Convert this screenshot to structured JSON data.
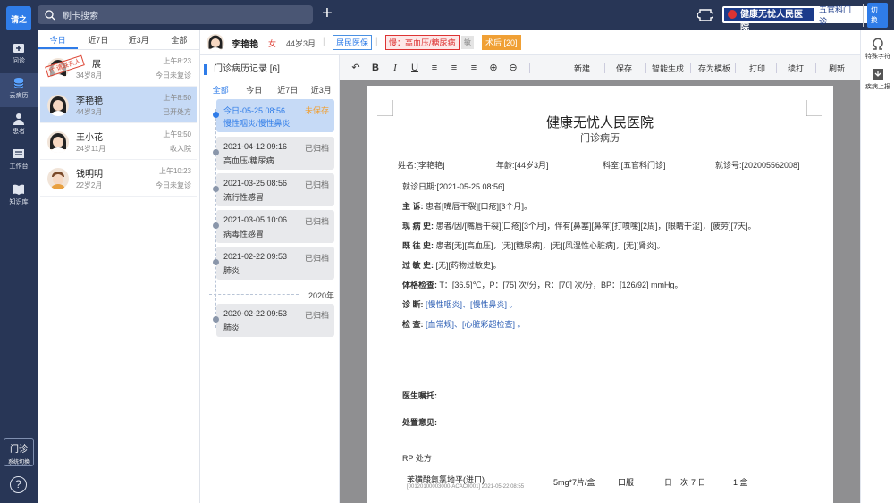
{
  "app": {
    "logo_label": "请之",
    "search_placeholder": "刷卡搜索",
    "plus": "+",
    "hospital_name": "健康无忧人民医院",
    "department": "五官科门诊",
    "switch_label": "切换"
  },
  "leftnav": [
    {
      "label": "问诊",
      "icon": "consult-icon"
    },
    {
      "label": "云病历",
      "icon": "cloud-record-icon"
    },
    {
      "label": "患者",
      "icon": "patient-icon"
    },
    {
      "label": "工作台",
      "icon": "workbench-icon"
    },
    {
      "label": "知识库",
      "icon": "knowledge-icon"
    }
  ],
  "clinic_switch": {
    "label": "门诊",
    "sub": "系统切换"
  },
  "help": "?",
  "patient_tabs": [
    "今日",
    "近7日",
    "近3月",
    "全部"
  ],
  "patients": [
    {
      "name": "展",
      "info": "34岁8月",
      "time": "上午8:23",
      "status": "今日未复诊",
      "stamp": "代 请联系人"
    },
    {
      "name": "李艳艳",
      "info": "44岁3月",
      "time": "上午8:50",
      "status": "已开处方"
    },
    {
      "name": "王小花",
      "info": "24岁11月",
      "time": "上午9:50",
      "status": "收入院"
    },
    {
      "name": "钱明明",
      "info": "22岁2月",
      "time": "上午10:23",
      "status": "今日未复诊"
    }
  ],
  "current_patient": {
    "name": "李艳艳",
    "sex": "女",
    "age": "44岁3月",
    "sep": "|",
    "insurance": "居民医保",
    "chronic": "慢：高血压/糖尿病",
    "shield": "敏",
    "post_op": "术后 [20]"
  },
  "right_tools": [
    {
      "label": "特殊字符",
      "icon": "omega-icon"
    },
    {
      "label": "疾病上报",
      "icon": "report-icon"
    }
  ],
  "history": {
    "title": "门诊病历记录 [6]",
    "tabs": [
      "全部",
      "今日",
      "近7日",
      "近3月"
    ],
    "records": [
      {
        "date": "今日-05-25  08:56",
        "status": "未保存",
        "diag": "慢性咽炎/慢性鼻炎"
      },
      {
        "date": "2021-04-12  09:16",
        "status": "已归档",
        "diag": "高血压/糖尿病"
      },
      {
        "date": "2021-03-25  08:56",
        "status": "已归档",
        "diag": "流行性感冒"
      },
      {
        "date": "2021-03-05  10:06",
        "status": "已归档",
        "diag": "病毒性感冒"
      },
      {
        "date": "2021-02-22  09:53",
        "status": "已归档",
        "diag": "肺炎"
      },
      {
        "date": "2020-02-22  09:53",
        "status": "已归档",
        "diag": "肺炎"
      }
    ],
    "year_label": "2020年"
  },
  "toolbar": {
    "actions": [
      "新建",
      "保存",
      "智能生成",
      "存为模板",
      "打印",
      "续打",
      "刷新"
    ]
  },
  "document": {
    "title": "健康无忧人民医院",
    "subtitle": "门诊病历",
    "name": "姓名:[李艳艳]",
    "age": "年龄:[44岁3月]",
    "dept": "科室:[五官科门诊]",
    "visit_no": "就诊号:[202005562008]",
    "visit_date": "就诊日期:[2021-05-25   08:56]",
    "complaint_label": "主      诉:",
    "complaint": "患者[嘴唇干裂][口疮][3个月]。",
    "present_label": "现 病 史:",
    "present": "患者/因/[嘴唇干裂][口疮][3个月]，伴有[鼻塞][鼻痒][打喷嚏][2周]，[眼睛干涩]，[疲劳][7天]。",
    "past_label": "既 往 史:",
    "past": "患者[无][高血压]，[无][糖尿病]，[无][风湿性心脏病]，[无][肾炎]。",
    "allergy_label": "过 敏 史:",
    "allergy": "[无][药物过敏史]。",
    "exam_label": "体格检查:",
    "exam": "T：[36.5]℃，P：[75] 次/分，R：[70] 次/分，BP：[126/92] mmHg。",
    "diag_label": "诊      断:",
    "diag": "[慢性咽炎]、[慢性鼻炎] 。",
    "check_label": "检      查:",
    "check": "[血常规]、[心脏彩超检查] 。",
    "advice_label": "医生嘱托:",
    "opinion_label": "处置意见:",
    "rp_label": "RP 处方",
    "rx_name": "苯磺酸氨氯地平(进口)",
    "rx_code": "[00120100003000-ACAC0001] 2021-05-22 08:55",
    "rx_spec": "5mg*7片/盒",
    "rx_route": "口服",
    "rx_freq": "一日一次",
    "rx_days": "7 日",
    "rx_qty": "1 盒"
  }
}
